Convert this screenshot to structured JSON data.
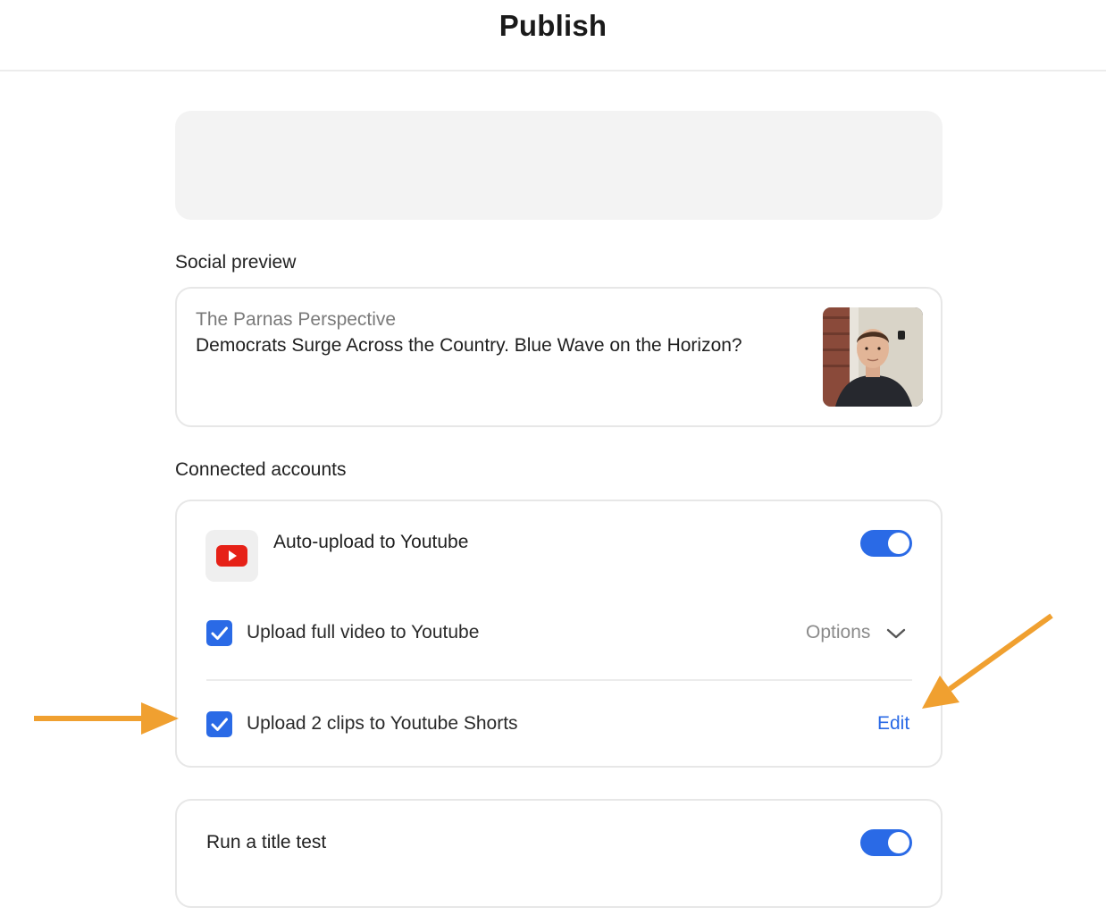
{
  "header": {
    "title": "Publish"
  },
  "social_preview": {
    "section_label": "Social preview",
    "source": "The Parnas Perspective",
    "headline": "Democrats Surge Across the Country. Blue Wave on the Horizon?"
  },
  "connected_accounts": {
    "section_label": "Connected accounts",
    "youtube": {
      "label": "Auto-upload to Youtube",
      "enabled": true,
      "full_video": {
        "label": "Upload full video to Youtube",
        "checked": true,
        "options_label": "Options"
      },
      "shorts": {
        "label": "Upload 2 clips to Youtube Shorts",
        "checked": true,
        "edit_label": "Edit"
      }
    }
  },
  "title_test": {
    "label": "Run a title test",
    "enabled": true
  },
  "colors": {
    "accent": "#2a6ae6",
    "youtube_red": "#e62117",
    "annotation_orange": "#f0a030"
  },
  "icons": [
    "youtube-icon",
    "checkmark-icon",
    "chevron-down-icon",
    "annotation-arrow"
  ]
}
